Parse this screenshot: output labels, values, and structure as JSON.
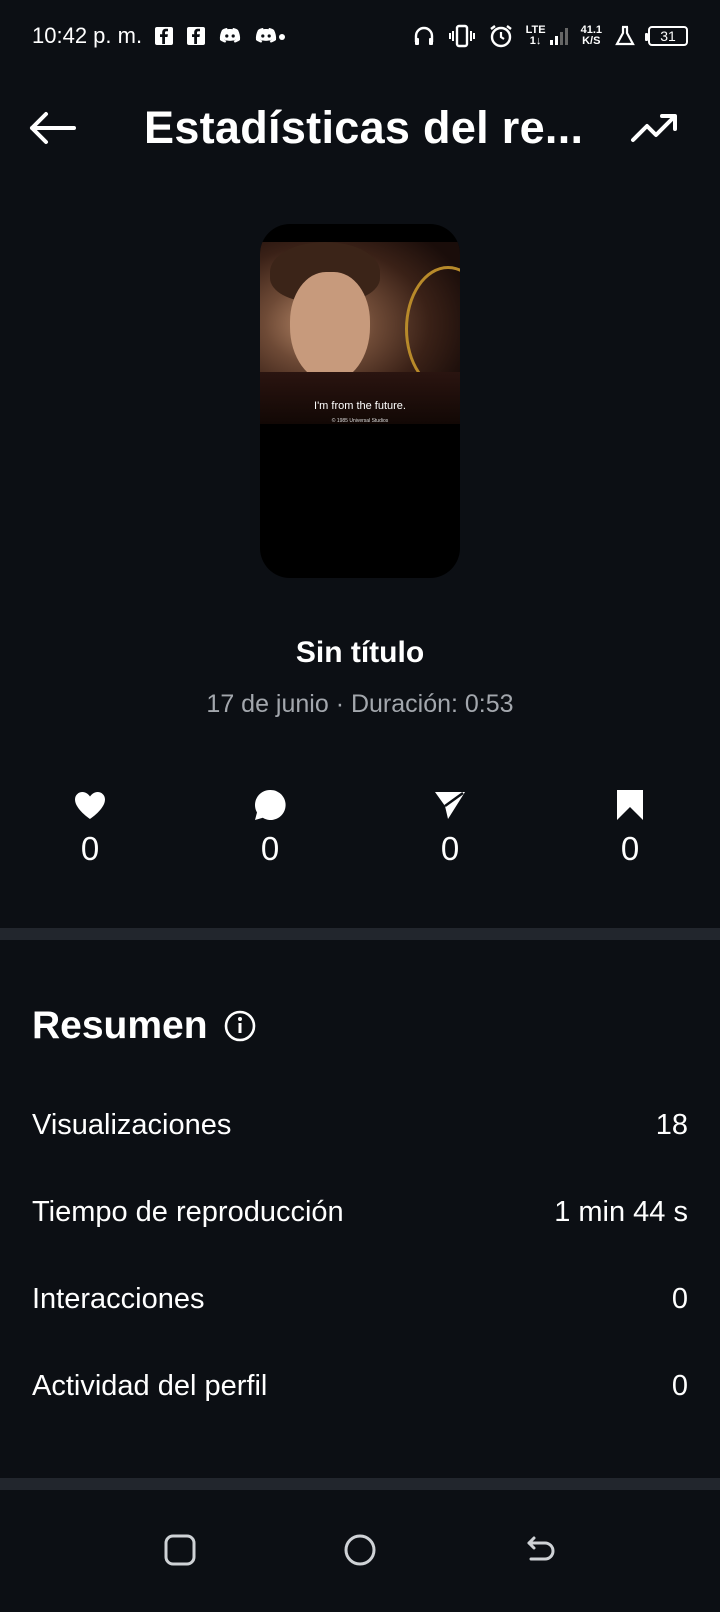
{
  "status_bar": {
    "time": "10:42 p. m.",
    "notif_icons": [
      "facebook-icon",
      "facebook-icon",
      "discord-icon",
      "discord-icon"
    ],
    "lte_top": "LTE",
    "lte_bottom": "1↓",
    "net_speed_value": "41.1",
    "net_speed_unit": "K/S",
    "battery": "31"
  },
  "header": {
    "title": "Estadísticas del re..."
  },
  "post": {
    "caption": "I'm from the future.",
    "caption_sub": "© 1985 Universal Studios",
    "title": "Sin título",
    "meta": "17 de junio · Duración: 0:53"
  },
  "engagement": [
    {
      "icon": "heart-icon",
      "value": "0"
    },
    {
      "icon": "comment-icon",
      "value": "0"
    },
    {
      "icon": "share-icon",
      "value": "0"
    },
    {
      "icon": "bookmark-icon",
      "value": "0"
    }
  ],
  "summary": {
    "title": "Resumen",
    "rows": [
      {
        "label": "Visualizaciones",
        "value": "18"
      },
      {
        "label": "Tiempo de reproducción",
        "value": "1 min 44 s"
      },
      {
        "label": "Interacciones",
        "value": "0"
      },
      {
        "label": "Actividad del perfil",
        "value": "0"
      }
    ]
  },
  "colors": {
    "background": "#0c0f14",
    "divider": "#22262d",
    "meta_text": "#a3a7ad"
  }
}
